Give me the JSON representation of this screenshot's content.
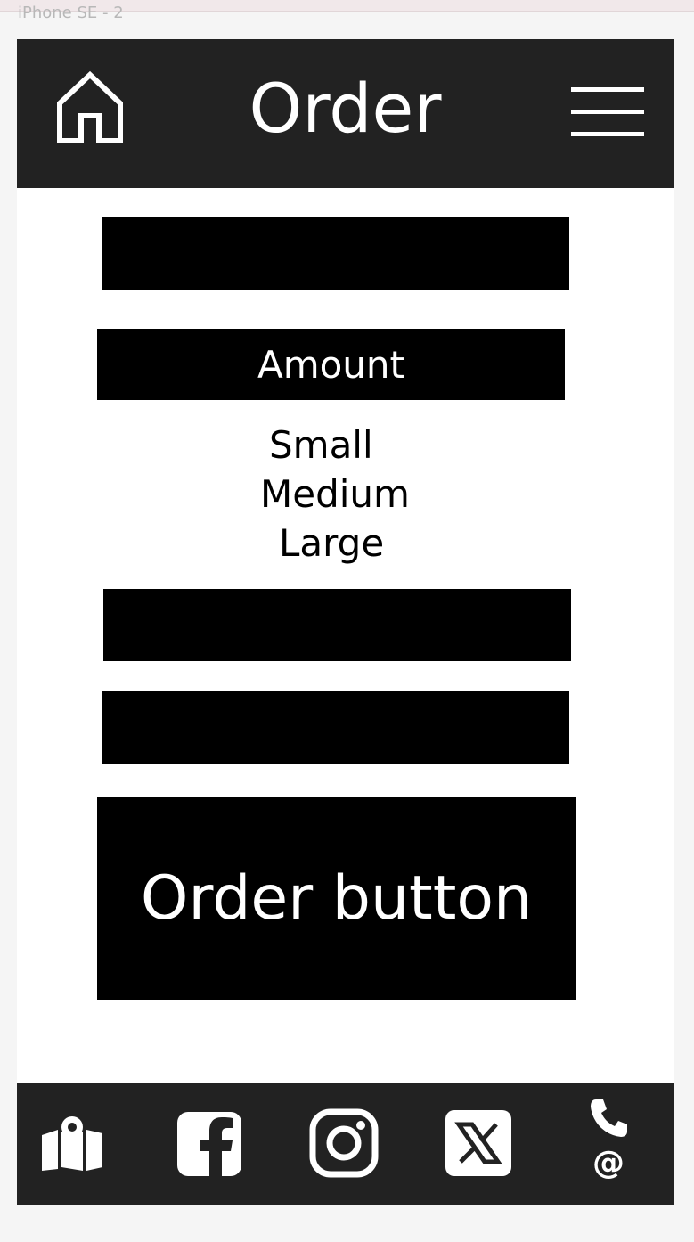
{
  "frame": {
    "label": "iPhone SE - 2"
  },
  "header": {
    "title": "Order",
    "home_icon": "home-icon",
    "menu_icon": "hamburger-menu-icon"
  },
  "form": {
    "amount_label": "Amount",
    "sizes": [
      "Small",
      "Medium",
      "Large"
    ],
    "order_button_label": "Order button"
  },
  "footer": {
    "icons": [
      "map-icon",
      "facebook-icon",
      "instagram-icon",
      "x-twitter-icon",
      "phone-icon"
    ],
    "email_symbol": "@"
  },
  "colors": {
    "bar_background": "#222222",
    "block": "#000000",
    "text_on_dark": "#ffffff",
    "page_background": "#f5f5f5"
  }
}
